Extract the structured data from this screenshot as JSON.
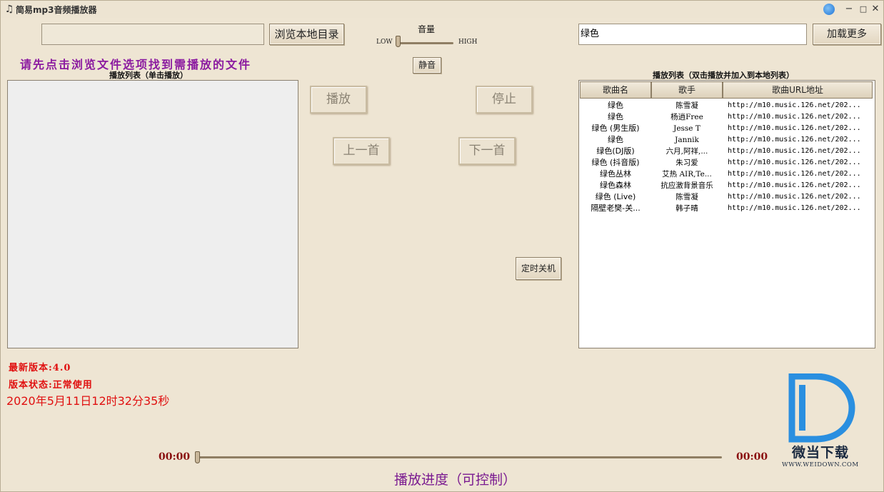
{
  "window": {
    "title": "简易mp3音频播放器",
    "controls": {
      "minimize": "−",
      "maximize": "□",
      "close": "✕"
    }
  },
  "top": {
    "path_value": "",
    "browse_label": "浏览本地目录",
    "search_value": "绿色",
    "load_more_label": "加载更多"
  },
  "volume": {
    "label": "音量",
    "low": "LOW",
    "high": "HIGH",
    "level": 0.0,
    "mute_label": "静音"
  },
  "hint_text": "请先点击浏览文件选项找到需播放的文件",
  "left_list": {
    "title": "播放列表（单击播放）"
  },
  "controls": {
    "play": "播放",
    "stop": "停止",
    "prev": "上一首",
    "next": "下一首",
    "timer_shutdown": "定时关机"
  },
  "right_list": {
    "title": "播放列表（双击播放并加入到本地列表）",
    "columns": [
      "歌曲名",
      "歌手",
      "歌曲URL地址"
    ],
    "rows": [
      {
        "song": "绿色",
        "artist": "陈雪凝",
        "url": "http://m10.music.126.net/202..."
      },
      {
        "song": "绿色",
        "artist": "杨逍Free",
        "url": "http://m10.music.126.net/202..."
      },
      {
        "song": "绿色 (男生版)",
        "artist": "Jesse T",
        "url": "http://m10.music.126.net/202..."
      },
      {
        "song": "绿色",
        "artist": "Jannik",
        "url": "http://m10.music.126.net/202..."
      },
      {
        "song": "绿色(DJ版)",
        "artist": "六月,阿祥,...",
        "url": "http://m10.music.126.net/202..."
      },
      {
        "song": "绿色 (抖音版)",
        "artist": "朱习爱",
        "url": "http://m10.music.126.net/202..."
      },
      {
        "song": "绿色丛林",
        "artist": "艾热 AIR,Te...",
        "url": "http://m10.music.126.net/202..."
      },
      {
        "song": "绿色森林",
        "artist": "抗应激背景音乐",
        "url": "http://m10.music.126.net/202..."
      },
      {
        "song": "绿色 (Live)",
        "artist": "陈雪凝",
        "url": "http://m10.music.126.net/202..."
      },
      {
        "song": "隔壁老樊-关...",
        "artist": "韩子晴",
        "url": "http://m10.music.126.net/202..."
      }
    ]
  },
  "info": {
    "version": "最新版本:4.0",
    "status": "版本状态:正常使用",
    "datetime": "2020年5月11日12时32分35秒"
  },
  "progress": {
    "current": "00:00",
    "total": "00:00",
    "fraction": 0.0,
    "label": "播放进度（可控制）"
  },
  "watermark": {
    "cn": "微当下载",
    "en": "WWW.WEIDOWN.COM",
    "color": "#2a8fe0"
  }
}
